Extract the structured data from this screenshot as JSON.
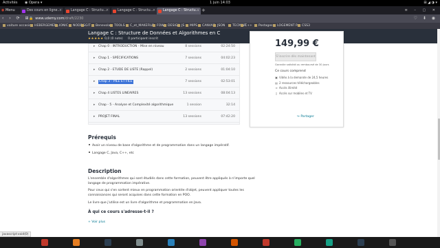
{
  "system": {
    "activities": "Activités",
    "browser_name": "Opera",
    "clock": "1 juin  14:03",
    "tray": "⊞ ◢ ◑ ▾"
  },
  "tabs": {
    "menu_label": "Menu",
    "items": [
      {
        "label": "Des cours en ligne..."
      },
      {
        "label": "Langage C : Structu..."
      },
      {
        "label": "Langage C : Structu..."
      },
      {
        "label": "Langage C : Structu..."
      }
    ],
    "new_tab": "+"
  },
  "address": {
    "url_host": "www.udemy.com",
    "url_path": "/draft/2230"
  },
  "bookmarks": [
    "voiture occasion",
    "HEBERGEMEN...",
    "IONIC",
    "NODEJS",
    "GIT",
    "Benevolat",
    "TOOLS",
    "C_et_MAKEFILE",
    "FOW",
    "DESIGN",
    "JS",
    "MIPS",
    "CANVAS",
    "JSON",
    "TECMINT",
    "C++",
    "Postages",
    "LOGEMENT P...",
    "CSS3"
  ],
  "hero": {
    "title": "Langage C : Structure de Données et  Algorithmes en C",
    "stars": "★★★★★",
    "rating": "0,0 (0 note)",
    "participants": "0 participant inscrit"
  },
  "curriculum": [
    {
      "name": "Chap 0 : INTRODUCTION - Mise en niveau",
      "sessions": "8 sessions",
      "duration": "02:24:50"
    },
    {
      "name": "Chap 1 - SPÉCIFICATIONS",
      "sessions": "7 sessions",
      "duration": "04:02:23"
    },
    {
      "name": "Chap 2 - ETUDE DE LISTE (Rappel)",
      "sessions": "2 sessions",
      "duration": "01:04:10"
    },
    {
      "name": "Chap 3 - PILE ET FILE",
      "sessions": "7 sessions",
      "duration": "02:53:01",
      "highlighted": true
    },
    {
      "name": "Chap 4 LISTES LINEAIRES",
      "sessions": "13 sessions",
      "duration": "08:04:13"
    },
    {
      "name": "Chap - 5 - Analyse et Complexité algorithmique",
      "sessions": "1 session",
      "duration": "32:14"
    },
    {
      "name": "PROJET FINAL",
      "sessions": "13 sessions",
      "duration": "07:42:20"
    }
  ],
  "card": {
    "price": "149,99 €",
    "buy_label": "S'inscrire dès maintenant",
    "guarantee": "Garantie satisfait ou remboursé de 30 jours",
    "includes_title": "Ce cours comprend",
    "includes": [
      {
        "icon": "video-icon",
        "glyph": "▣",
        "text": "Vidéo à la demande de 24,5 heures"
      },
      {
        "icon": "file-icon",
        "glyph": "▤",
        "text": "2 ressources téléchargeables"
      },
      {
        "icon": "infinity-icon",
        "glyph": "∞",
        "text": "Accès illimité"
      },
      {
        "icon": "mobile-icon",
        "glyph": "▯",
        "text": "Accès sur mobiles et TV"
      }
    ],
    "share": "Partager"
  },
  "prereq": {
    "title": "Prérequis",
    "items": [
      "Avoir un niveau de base d'algorithme et de programmation dans un langage impératif.",
      "Langage C, Java, C++, etc"
    ]
  },
  "description": {
    "title": "Description",
    "p1": "L'ensemble d'algorithmes qui sont étudiés dans cette formation, peuvent être appliqués à n'importe quel langage de programmation impérative.",
    "p2": "Pour ceux qui s'en sortent mieux en programmation orientée d'objet, peuvent  appliquer toutes les connaissances qui seront acquises dans cette formation en POO.",
    "p3": "Le livre que j'utilise est un livre d'algorithme et programmation en Java.",
    "who_title": "À qui ce cours s'adresse-t-il ?",
    "see_more": "+ Voir plus"
  },
  "status_url": "javascript:void(0)",
  "colors": {
    "hero_bg": "#29303b",
    "accent": "#007791",
    "selection": "#3d74d8"
  }
}
